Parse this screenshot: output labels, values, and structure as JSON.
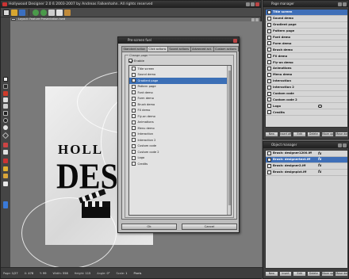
{
  "app": {
    "title": "Hollywood Designer 2.0 ß  2003-2007 by Andreas Falkenhahn. All rights reserved",
    "document_title": "Layout: Feature Presentation.hwd"
  },
  "status": {
    "page_label": "Page:",
    "page": "1/27",
    "x_label": "X:",
    "x": "478",
    "y_label": "Y:",
    "y": "99",
    "width_label": "Width:",
    "width": "558",
    "height_label": "Height:",
    "height": "115",
    "angle_label": "Angle:",
    "angle": "0°",
    "scale_label": "Scale:",
    "scale": "1",
    "units": "Pixels"
  },
  "canvas": {
    "title_top": "HOLL",
    "title_big": "DES"
  },
  "dialog": {
    "title": "Pre-screen fuel",
    "tabs": [
      "Standard action",
      "Click actions",
      "Sound actions",
      "Advanced act.",
      "Custom actions"
    ],
    "active_tab": 1,
    "group_label": "Change page",
    "enable_label": "Enable",
    "pages": [
      "Title screen",
      "Sound demo",
      "Gradient page",
      "Pattern page",
      "Font demo",
      "Form demo",
      "Brush demo",
      "FX demo",
      "Fly-on demo",
      "Animations",
      "Menu demo",
      "Interaction",
      "Interaction 2",
      "Custom code",
      "Custom code 2",
      "Logo",
      "Credits"
    ],
    "selected_index": 2,
    "ok_label": "Ok",
    "cancel_label": "Cancel"
  },
  "page_manager": {
    "title": "Page manager",
    "pages": [
      "Title screen",
      "Sound demo",
      "Gradient page",
      "Pattern page",
      "Font demo",
      "Form demo",
      "Brush demo",
      "FX demo",
      "Fly-on demo",
      "Animations",
      "Menu demo",
      "Interaction",
      "Interaction 2",
      "Custom code",
      "Custom code 2",
      "Logo",
      "Credits"
    ],
    "selected_index": 0,
    "buttons": [
      "New",
      "Insert after",
      "Edit",
      "Delete",
      "Move up",
      "Move down"
    ]
  },
  "object_manager": {
    "title": "Object manager",
    "objects": [
      "Brush: designer1200.iff",
      "Brush: designertext.iff",
      "Brush: designer2.iff",
      "Brush: designpict.iff"
    ],
    "selected_index": 1,
    "fx_label": "fx",
    "buttons": [
      "New",
      "Insert",
      "Edit",
      "Delete",
      "Move up",
      "Move down"
    ]
  },
  "colors": {
    "selection": "#3f6fb8",
    "window_bg": "#3b3b3b",
    "canvas_bg": "#7a7a7a",
    "dialog_bg": "#bdbdbd"
  }
}
